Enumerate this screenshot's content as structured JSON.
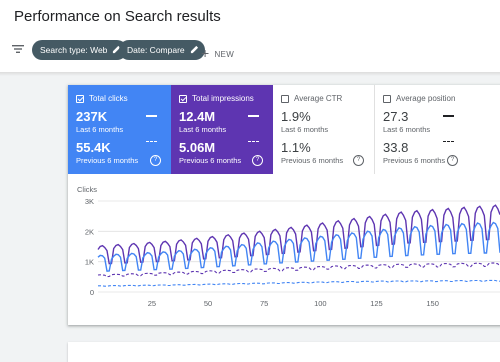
{
  "header": {
    "title": "Performance on Search results"
  },
  "filters": {
    "chips": [
      {
        "label": "Search type: Web"
      },
      {
        "label": "Date: Compare"
      }
    ],
    "new_label": "NEW"
  },
  "metrics": [
    {
      "label": "Total clicks",
      "checked": true,
      "current": "237K",
      "current_period": "Last 6 months",
      "previous": "55.4K",
      "previous_period": "Previous 6 months",
      "color": "#4285f4"
    },
    {
      "label": "Total impressions",
      "checked": true,
      "current": "12.4M",
      "current_period": "Last 6 months",
      "previous": "5.06M",
      "previous_period": "Previous 6 months",
      "color": "#5e35b1"
    },
    {
      "label": "Average CTR",
      "checked": false,
      "current": "1.9%",
      "current_period": "Last 6 months",
      "previous": "1.1%",
      "previous_period": "Previous 6 months",
      "color": "#00897b"
    },
    {
      "label": "Average position",
      "checked": false,
      "current": "27.3",
      "current_period": "Last 6 months",
      "previous": "33.8",
      "previous_period": "Previous 6 months",
      "color": "#e8710a"
    }
  ],
  "chart_data": {
    "type": "line",
    "ylabel": "Clicks",
    "yticks": [
      "3K",
      "2K",
      "1K",
      "0"
    ],
    "ylim": [
      0,
      3000
    ],
    "xticks": [
      25,
      50,
      75,
      100,
      125,
      150
    ],
    "xlim": [
      1,
      180
    ],
    "grid": true,
    "series": [
      {
        "style": "solid",
        "color": "#5e35b1",
        "y": [
          1400,
          1450,
          1500,
          1550,
          1620,
          1700,
          1780,
          1860,
          1950,
          2050,
          2150,
          2250,
          2350,
          2450,
          2500,
          2550,
          2600,
          2650
        ]
      },
      {
        "style": "solid",
        "color": "#4285f4",
        "y": [
          1100,
          1150,
          1180,
          1220,
          1280,
          1350,
          1420,
          1500,
          1580,
          1650,
          1720,
          1800,
          1880,
          1950,
          2000,
          2050,
          2080,
          2100
        ]
      },
      {
        "style": "dashed",
        "color": "#5e35b1",
        "y": [
          550,
          580,
          600,
          630,
          660,
          690,
          720,
          750,
          780,
          810,
          840,
          860,
          880,
          900,
          910,
          920,
          930,
          940
        ]
      },
      {
        "style": "dashed",
        "color": "#4285f4",
        "y": [
          200,
          210,
          220,
          230,
          245,
          260,
          275,
          290,
          305,
          320,
          335,
          345,
          355,
          360,
          365,
          370,
          375,
          380
        ]
      }
    ]
  }
}
